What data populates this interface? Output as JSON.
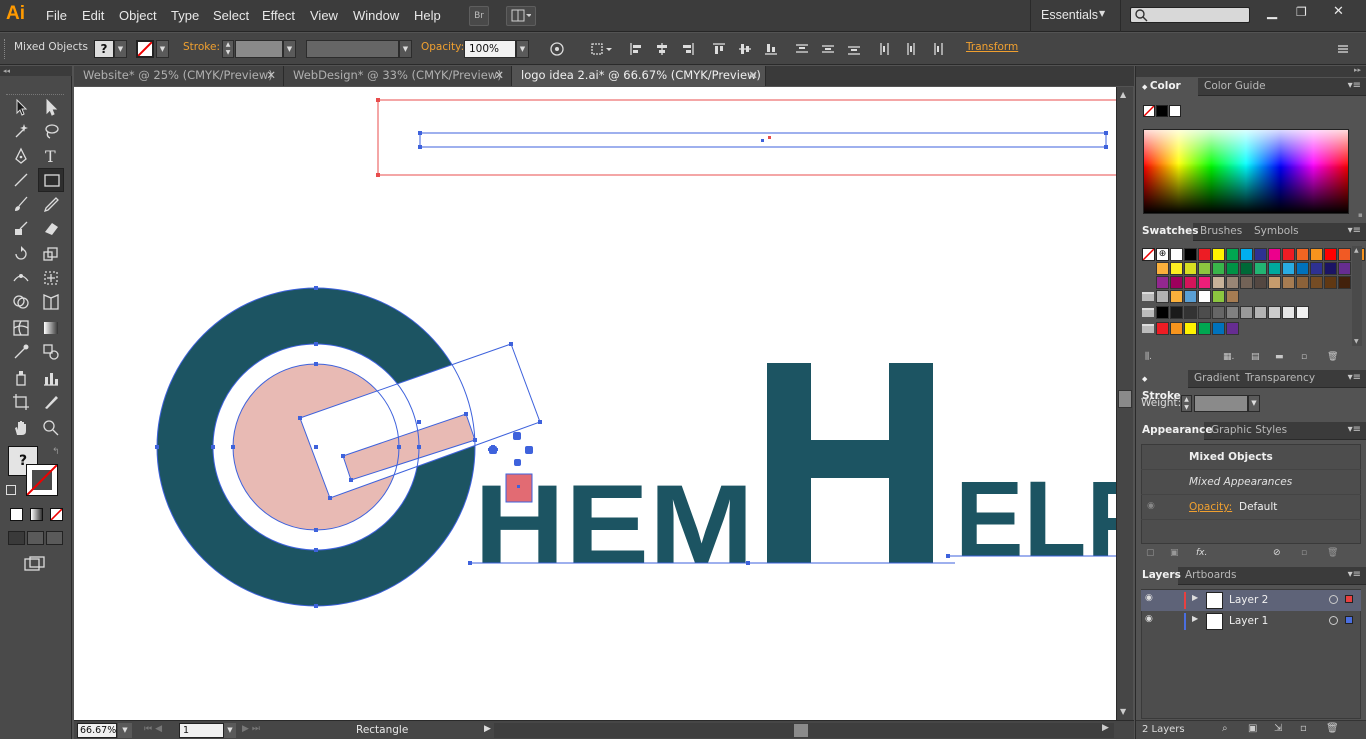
{
  "app": {
    "logo": "Ai"
  },
  "menu": [
    "File",
    "Edit",
    "Object",
    "Type",
    "Select",
    "Effect",
    "View",
    "Window",
    "Help"
  ],
  "menubar": {
    "bridge_label": "Br",
    "workspace": "Essentials"
  },
  "control_bar": {
    "selection": "Mixed Objects",
    "stroke_label": "Stroke:",
    "opacity_label": "Opacity:",
    "opacity_value": "100%",
    "transform_label": "Transform",
    "fill_question": "?"
  },
  "tabs": [
    {
      "label": "Website* @ 25% (CMYK/Preview)",
      "active": false
    },
    {
      "label": "WebDesign* @ 33% (CMYK/Preview)",
      "active": false
    },
    {
      "label": "logo idea 2.ai* @ 66.67% (CMYK/Preview)",
      "active": true
    }
  ],
  "toolbar": {
    "fill_question": "?"
  },
  "artwork": {
    "letters": "HEMHEL",
    "teal": "#1c5462",
    "pink": "#e8bab4",
    "selection_blue": "#3e62dc",
    "artboard_red": "#e84c4c"
  },
  "status": {
    "zoom": "66.67%",
    "page": "1",
    "tool": "Rectangle"
  },
  "panels": {
    "color_tabs": [
      "Color",
      "Color Guide"
    ],
    "swatch_tabs": [
      "Swatches",
      "Brushes",
      "Symbols"
    ],
    "stroke_tabs": [
      "Stroke",
      "Gradient",
      "Transparency"
    ],
    "weight_label": "Weight:",
    "appearance_tabs": [
      "Appearance",
      "Graphic Styles"
    ],
    "appearance_title": "Mixed Objects",
    "appearance_sub": "Mixed Appearances",
    "opacity_label": "Opacity:",
    "opacity_value": "Default",
    "layers_tabs": [
      "Layers",
      "Artboards"
    ],
    "layers": [
      {
        "name": "Layer 2",
        "color": "#e84040"
      },
      {
        "name": "Layer 1",
        "color": "#4a6ee0"
      }
    ],
    "layers_count": "2 Layers"
  },
  "swatches": [
    [
      "#ffffff",
      "#000000",
      "#ed1c24",
      "#fff200",
      "#00a651",
      "#00aeef",
      "#2e3192",
      "#ec008c",
      "#ed1c24",
      "#f26522",
      "#f7941d",
      "#ff0000",
      "#f15a24",
      "#f7931e"
    ],
    [
      "#fbb03b",
      "#fcee21",
      "#d9e021",
      "#8cc63f",
      "#39b54a",
      "#009245",
      "#006837",
      "#22b573",
      "#00a99d",
      "#29abe2",
      "#0071bc",
      "#2e3192",
      "#1b1464",
      "#662d91"
    ],
    [
      "#93278f",
      "#9e005d",
      "#d4145a",
      "#ed1e79",
      "#c7b299",
      "#998675",
      "#736357",
      "#534741",
      "#c69c6d",
      "#a67c52",
      "#8c6239",
      "#754c24",
      "#603813",
      "#42210b"
    ],
    [
      "#b3b3b3",
      "#fbb03b",
      "#5a9fd4",
      "#ffffff",
      "#8cc63f",
      "#a67c52"
    ],
    [
      "#000000",
      "#1a1a1a",
      "#333333",
      "#4d4d4d",
      "#666666",
      "#808080",
      "#999999",
      "#b3b3b3",
      "#cccccc",
      "#e6e6e6",
      "#f2f2f2"
    ],
    [
      "#ed1c24",
      "#f7941d",
      "#fff200",
      "#00a651",
      "#0072bc",
      "#662d91"
    ]
  ]
}
